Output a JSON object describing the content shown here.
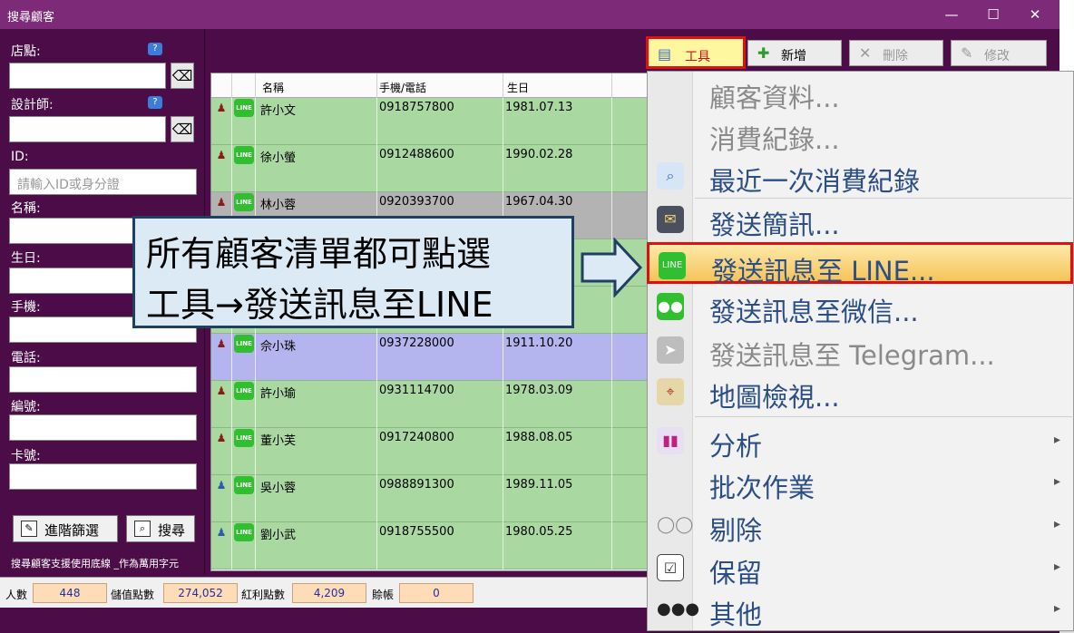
{
  "window": {
    "title": "搜尋顧客",
    "min": "—",
    "max": "☐",
    "close": "✕"
  },
  "left": {
    "store_label": "店點:",
    "designer_label": "設計師:",
    "id_label": "ID:",
    "id_placeholder": "請輸入ID或身分證",
    "name_label": "名稱:",
    "birthday_label": "生日:",
    "mobile_label": "手機:",
    "phone_label": "電話:",
    "number_label": "編號:",
    "card_label": "卡號:",
    "advanced_button": "進階篩選",
    "search_button": "搜尋",
    "note": "搜尋顧客支援使用底線 _作為萬用字元"
  },
  "toolbar": {
    "tool": "工具",
    "add": "新增",
    "delete": "刪除",
    "edit": "修改"
  },
  "grid": {
    "headers": [
      "名稱",
      "手機/電話",
      "生日"
    ],
    "rows": [
      {
        "name": "許小文",
        "phone": "0918757800",
        "birthday": "1981.07.13",
        "gender": "female",
        "color": "green"
      },
      {
        "name": "徐小螢",
        "phone": "0912488600",
        "birthday": "1990.02.28",
        "gender": "female",
        "color": "green"
      },
      {
        "name": "林小蓉",
        "phone": "0920393700",
        "birthday": "1967.04.30",
        "gender": "female",
        "color": "gray"
      },
      {
        "name": "",
        "phone": "",
        "birthday": "",
        "gender": "female",
        "color": "green"
      },
      {
        "name": "",
        "phone": "",
        "birthday": "",
        "gender": "female",
        "color": "green"
      },
      {
        "name": "佘小珠",
        "phone": "0937228000",
        "birthday": "1911.10.20",
        "gender": "female",
        "color": "purple"
      },
      {
        "name": "許小瑜",
        "phone": "0931114700",
        "birthday": "1978.03.09",
        "gender": "female",
        "color": "green"
      },
      {
        "name": "董小芙",
        "phone": "0917240800",
        "birthday": "1988.08.05",
        "gender": "female",
        "color": "green"
      },
      {
        "name": "吳小蓉",
        "phone": "0988891300",
        "birthday": "1989.11.05",
        "gender": "male",
        "color": "green"
      },
      {
        "name": "劉小武",
        "phone": "0918755500",
        "birthday": "1980.05.25",
        "gender": "male",
        "color": "green"
      }
    ]
  },
  "menu": {
    "items": [
      {
        "label": "顧客資料...",
        "disabled": true
      },
      {
        "label": "消費紀錄...",
        "disabled": true
      },
      {
        "label": "最近一次消費紀錄",
        "disabled": false
      },
      {
        "label": "發送簡訊...",
        "disabled": false
      },
      {
        "label": "發送訊息至 LINE...",
        "disabled": false
      },
      {
        "label": "發送訊息至微信...",
        "disabled": false
      },
      {
        "label": "發送訊息至 Telegram...",
        "disabled": true
      },
      {
        "label": "地圖檢視...",
        "disabled": false
      },
      {
        "label": "分析",
        "disabled": false
      },
      {
        "label": "批次作業",
        "disabled": false
      },
      {
        "label": "剔除",
        "disabled": false
      },
      {
        "label": "保留",
        "disabled": false
      },
      {
        "label": "其他",
        "disabled": false
      }
    ],
    "line_icon_text": "LINE"
  },
  "callout": {
    "line1": "所有顧客清單都可點選",
    "line2": "工具→發送訊息至LINE"
  },
  "status": {
    "count_label": "人數",
    "count_value": "448",
    "stored_label": "儲值點數",
    "stored_value": "274,052",
    "bonus_label": "紅利點數",
    "bonus_value": "4,209",
    "credit_label": "賒帳",
    "credit_value": "0"
  },
  "colors": {
    "window_bg": "#4b0c48",
    "titlebar": "#7d2a78",
    "row_green": "#a9d8a1",
    "row_gray": "#b3b3b3",
    "row_purple": "#b4b4ee",
    "menu_text": "#2b4e86",
    "highlight_border": "#e01010",
    "line_green": "#2fbf2f"
  }
}
